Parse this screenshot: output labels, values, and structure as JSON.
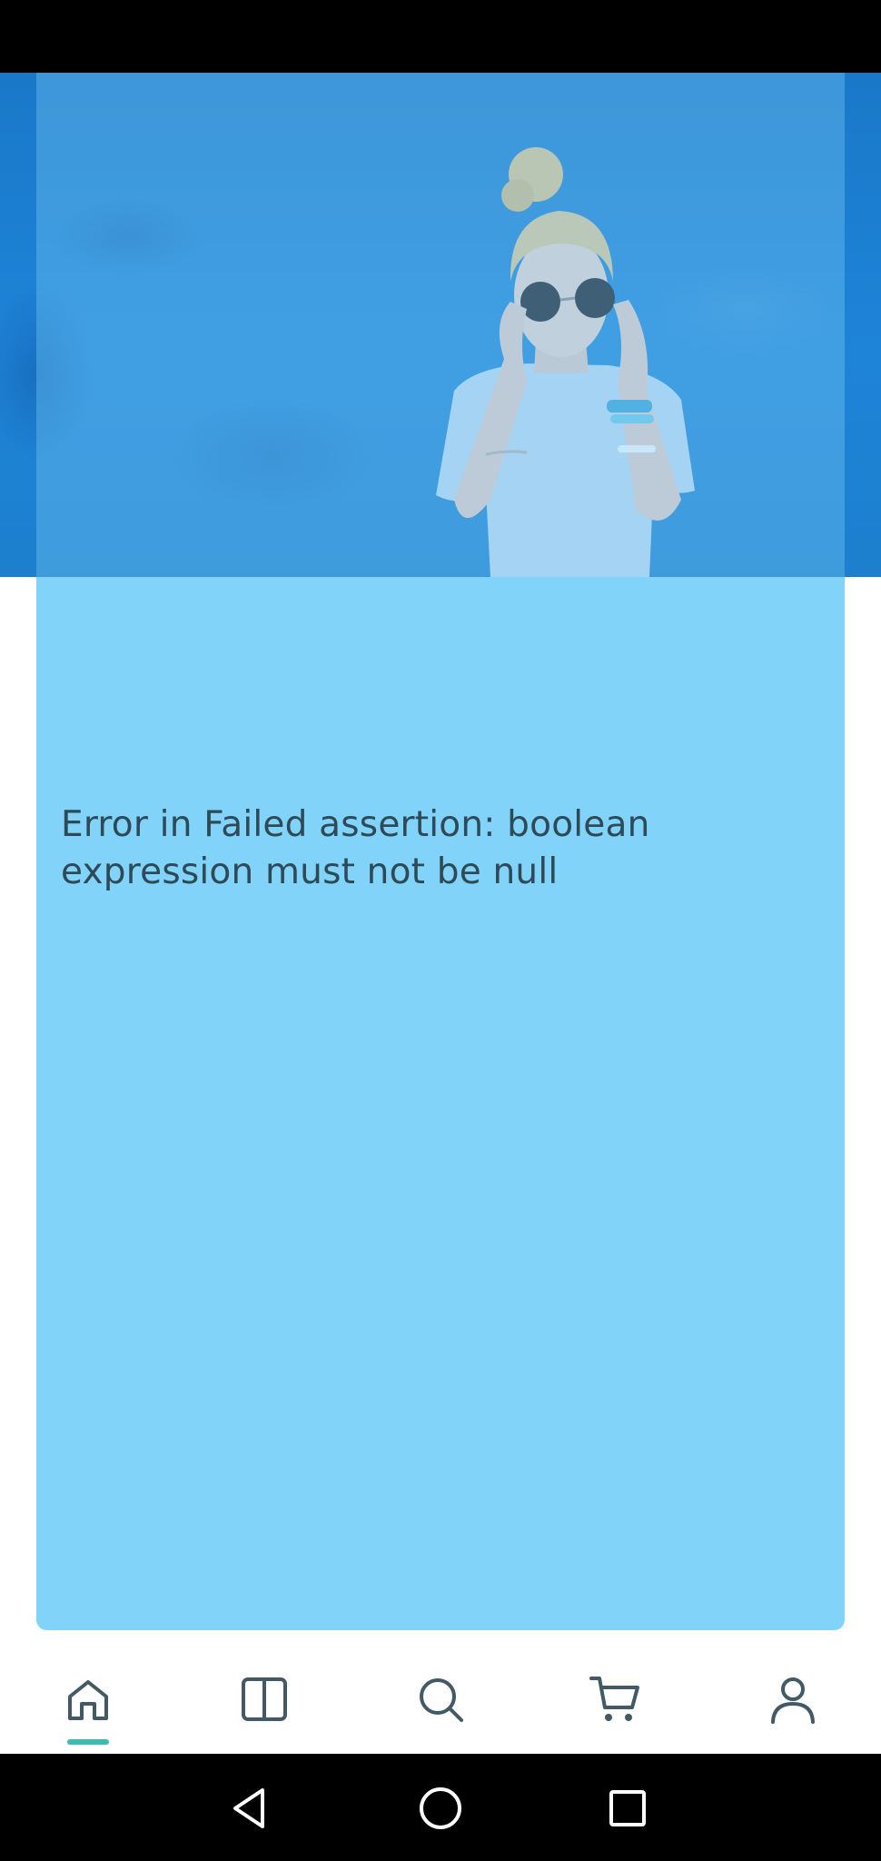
{
  "error": {
    "message": "Error in Failed assertion: boolean expression must not be null"
  },
  "bottom_nav": {
    "items": [
      {
        "icon": "home-icon",
        "active": true
      },
      {
        "icon": "book-icon",
        "active": false
      },
      {
        "icon": "search-icon",
        "active": false
      },
      {
        "icon": "cart-icon",
        "active": false
      },
      {
        "icon": "profile-icon",
        "active": false
      }
    ],
    "active_color": "#3dbdb1",
    "icon_color": "#425a66"
  },
  "system_nav": {
    "buttons": [
      "back-icon",
      "home-circle-icon",
      "recents-icon"
    ]
  },
  "colors": {
    "hero_blue": "#1e84d8",
    "card_blue": "#81d3f9",
    "text": "#2d4a56"
  }
}
